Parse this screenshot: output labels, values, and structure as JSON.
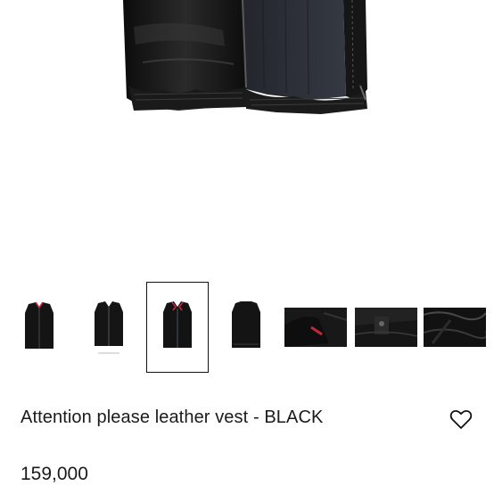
{
  "product": {
    "title": "Attention please leather vest - BLACK",
    "price": "159,000"
  },
  "gallery": {
    "selected_index": 2,
    "thumbnails": [
      {
        "view": "vest-front-on-dark-background"
      },
      {
        "view": "vest-front-on-white-background"
      },
      {
        "view": "vest-front-open"
      },
      {
        "view": "vest-back"
      },
      {
        "view": "vest-collar-detail"
      },
      {
        "view": "vest-pocket-detail"
      },
      {
        "view": "vest-leather-texture-detail"
      }
    ]
  },
  "icons": {
    "wishlist": "heart-icon"
  },
  "colors": {
    "leather": "#141414",
    "lining": "#2a2e35",
    "accent_red": "#c0283c"
  }
}
